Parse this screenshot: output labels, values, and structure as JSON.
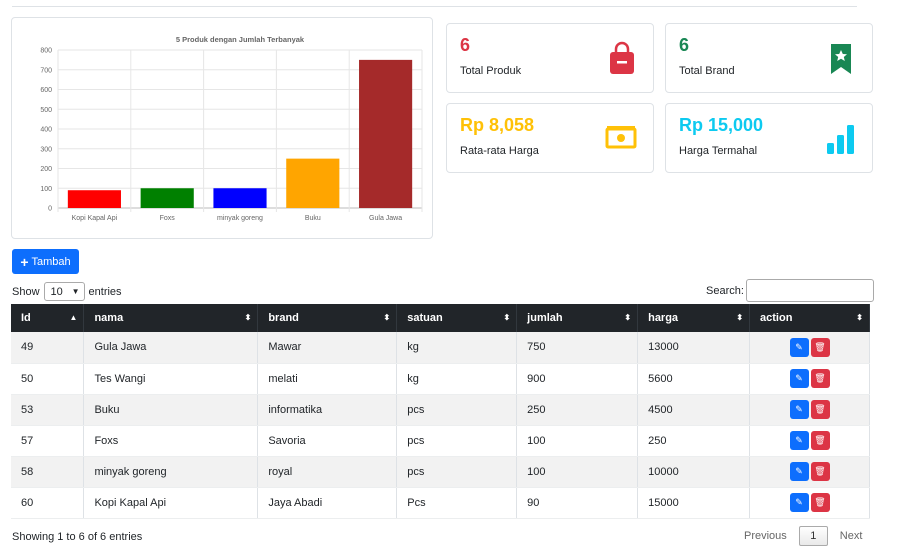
{
  "stats": [
    {
      "value": "6",
      "label": "Total Produk",
      "color": "#dc3545",
      "icon": "shopping-bag-icon"
    },
    {
      "value": "6",
      "label": "Total Brand",
      "color": "#198754",
      "icon": "bookmark-star-icon"
    },
    {
      "value": "Rp 8,058",
      "label": "Rata-rata Harga",
      "color": "#ffc107",
      "icon": "cash-icon"
    },
    {
      "value": "Rp 15,000",
      "label": "Harga Termahal",
      "color": "#0dcaf0",
      "icon": "bar-chart-icon"
    }
  ],
  "chart_data": {
    "type": "bar",
    "title": "5 Produk dengan Jumlah Terbanyak",
    "categories": [
      "Kopi Kapal Api",
      "Foxs",
      "minyak goreng",
      "Buku",
      "Gula Jawa"
    ],
    "values": [
      90,
      100,
      100,
      250,
      750
    ],
    "colors": [
      "#ff0000",
      "#008000",
      "#0000ff",
      "#ffa500",
      "#a52a2a"
    ],
    "ylim": [
      0,
      800
    ],
    "yticks": [
      0,
      100,
      200,
      300,
      400,
      500,
      600,
      700,
      800
    ],
    "grid": true,
    "legend": "none"
  },
  "toolbar": {
    "add_label": "Tambah"
  },
  "length": {
    "show": "Show",
    "value": "10",
    "entries": "entries"
  },
  "search": {
    "label": "Search:",
    "placeholder": ""
  },
  "table": {
    "headers": [
      "Id",
      "nama",
      "brand",
      "satuan",
      "jumlah",
      "harga",
      "action"
    ],
    "rows": [
      [
        "49",
        "Gula Jawa",
        "Mawar",
        "kg",
        "750",
        "13000"
      ],
      [
        "50",
        "Tes Wangi",
        "melati",
        "kg",
        "900",
        "5600"
      ],
      [
        "53",
        "Buku",
        "informatika",
        "pcs",
        "250",
        "4500"
      ],
      [
        "57",
        "Foxs",
        "Savoria",
        "pcs",
        "100",
        "250"
      ],
      [
        "58",
        "minyak goreng",
        "royal",
        "pcs",
        "100",
        "10000"
      ],
      [
        "60",
        "Kopi Kapal Api",
        "Jaya Abadi",
        "Pcs",
        "90",
        "15000"
      ]
    ]
  },
  "footer": {
    "info": "Showing 1 to 6 of 6 entries",
    "previous": "Previous",
    "page": "1",
    "next": "Next"
  }
}
